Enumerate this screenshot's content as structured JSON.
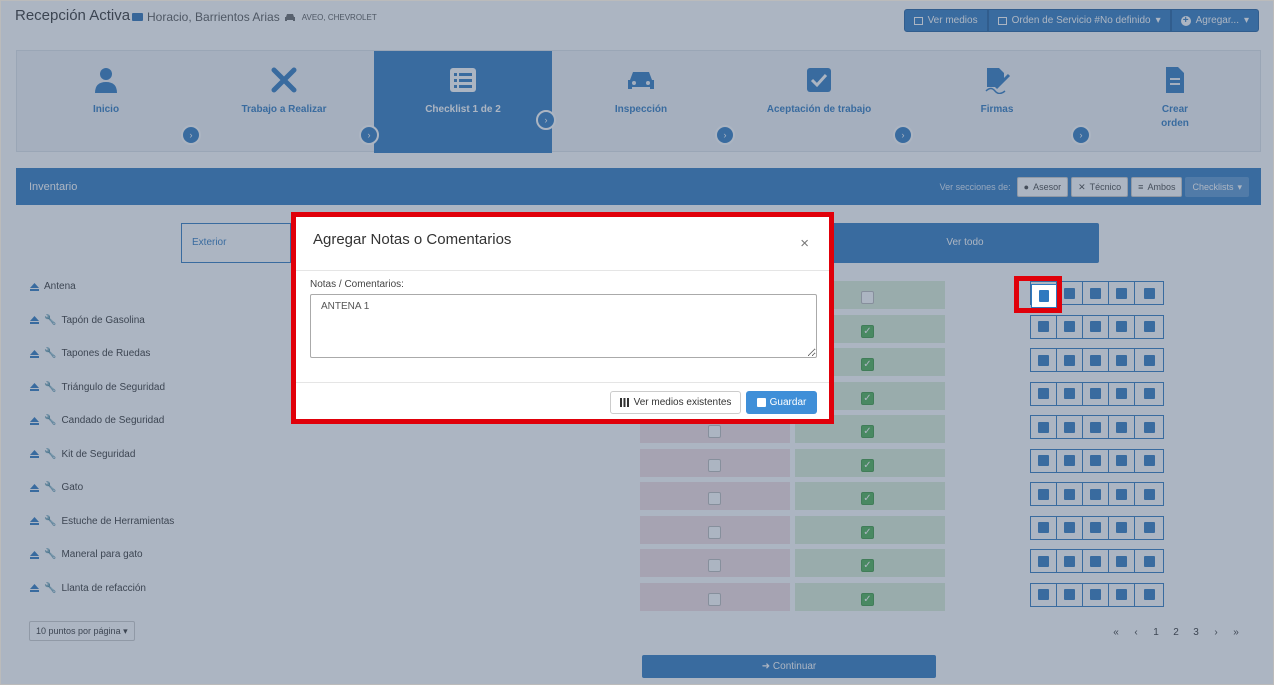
{
  "header": {
    "title": "Recepción Activa",
    "client_name": "Horacio, Barrientos Arias",
    "vehicle": "AVEO, CHEVROLET",
    "buttons": {
      "ver_medios": "Ver medios",
      "orden_servicio": "Orden de Servicio #No definido",
      "agregar": "Agregar..."
    }
  },
  "steps": [
    {
      "label": "Inicio",
      "icon": "user-icon"
    },
    {
      "label": "Trabajo a Realizar",
      "icon": "tools-icon"
    },
    {
      "label": "Checklist 1 de 2",
      "icon": "list-icon",
      "active": true
    },
    {
      "label": "Inspección",
      "icon": "car-icon"
    },
    {
      "label": "Aceptación de trabajo",
      "icon": "check-square-icon"
    },
    {
      "label": "Firmas",
      "icon": "signature-icon"
    },
    {
      "label": "Crear orden",
      "icon": "file-icon"
    }
  ],
  "panel": {
    "title": "Inventario",
    "ver_secciones_label": "Ver secciones de:",
    "asesor": "Asesor",
    "tecnico": "Técnico",
    "ambos": "Ambos",
    "checklists": "Checklists"
  },
  "tabs": {
    "exterior": "Exterior",
    "ver_todo": "Ver todo"
  },
  "rows": [
    {
      "name": "Antena",
      "wrench": false,
      "yes": false
    },
    {
      "name": "Tapón de Gasolina",
      "wrench": true,
      "yes": true
    },
    {
      "name": "Tapones de Ruedas",
      "wrench": true,
      "yes": true
    },
    {
      "name": "Triángulo de Seguridad",
      "wrench": true,
      "yes": true
    },
    {
      "name": "Candado de Seguridad",
      "wrench": true,
      "yes": true
    },
    {
      "name": "Kit de Seguridad",
      "wrench": true,
      "yes": true
    },
    {
      "name": "Gato",
      "wrench": true,
      "yes": true
    },
    {
      "name": "Estuche de Herramientas",
      "wrench": true,
      "yes": true
    },
    {
      "name": "Maneral para gato",
      "wrench": true,
      "yes": true
    },
    {
      "name": "Llanta de refacción",
      "wrench": true,
      "yes": true
    }
  ],
  "footer": {
    "per_page": "10 puntos por página",
    "pages": [
      "«",
      "‹",
      "1",
      "2",
      "3",
      "›",
      "»"
    ],
    "continuar": "Continuar"
  },
  "modal": {
    "title": "Agregar Notas o Comentarios",
    "close": "×",
    "notes_label": "Notas / Comentarios:",
    "notes_value": "ANTENA 1",
    "ver_medios": "Ver medios existentes",
    "guardar": "Guardar"
  },
  "colors": {
    "primary": "#2f79bf",
    "highlight": "#e0000a",
    "yes_cell": "#dcefd8",
    "no_cell": "#f4dfe2"
  }
}
